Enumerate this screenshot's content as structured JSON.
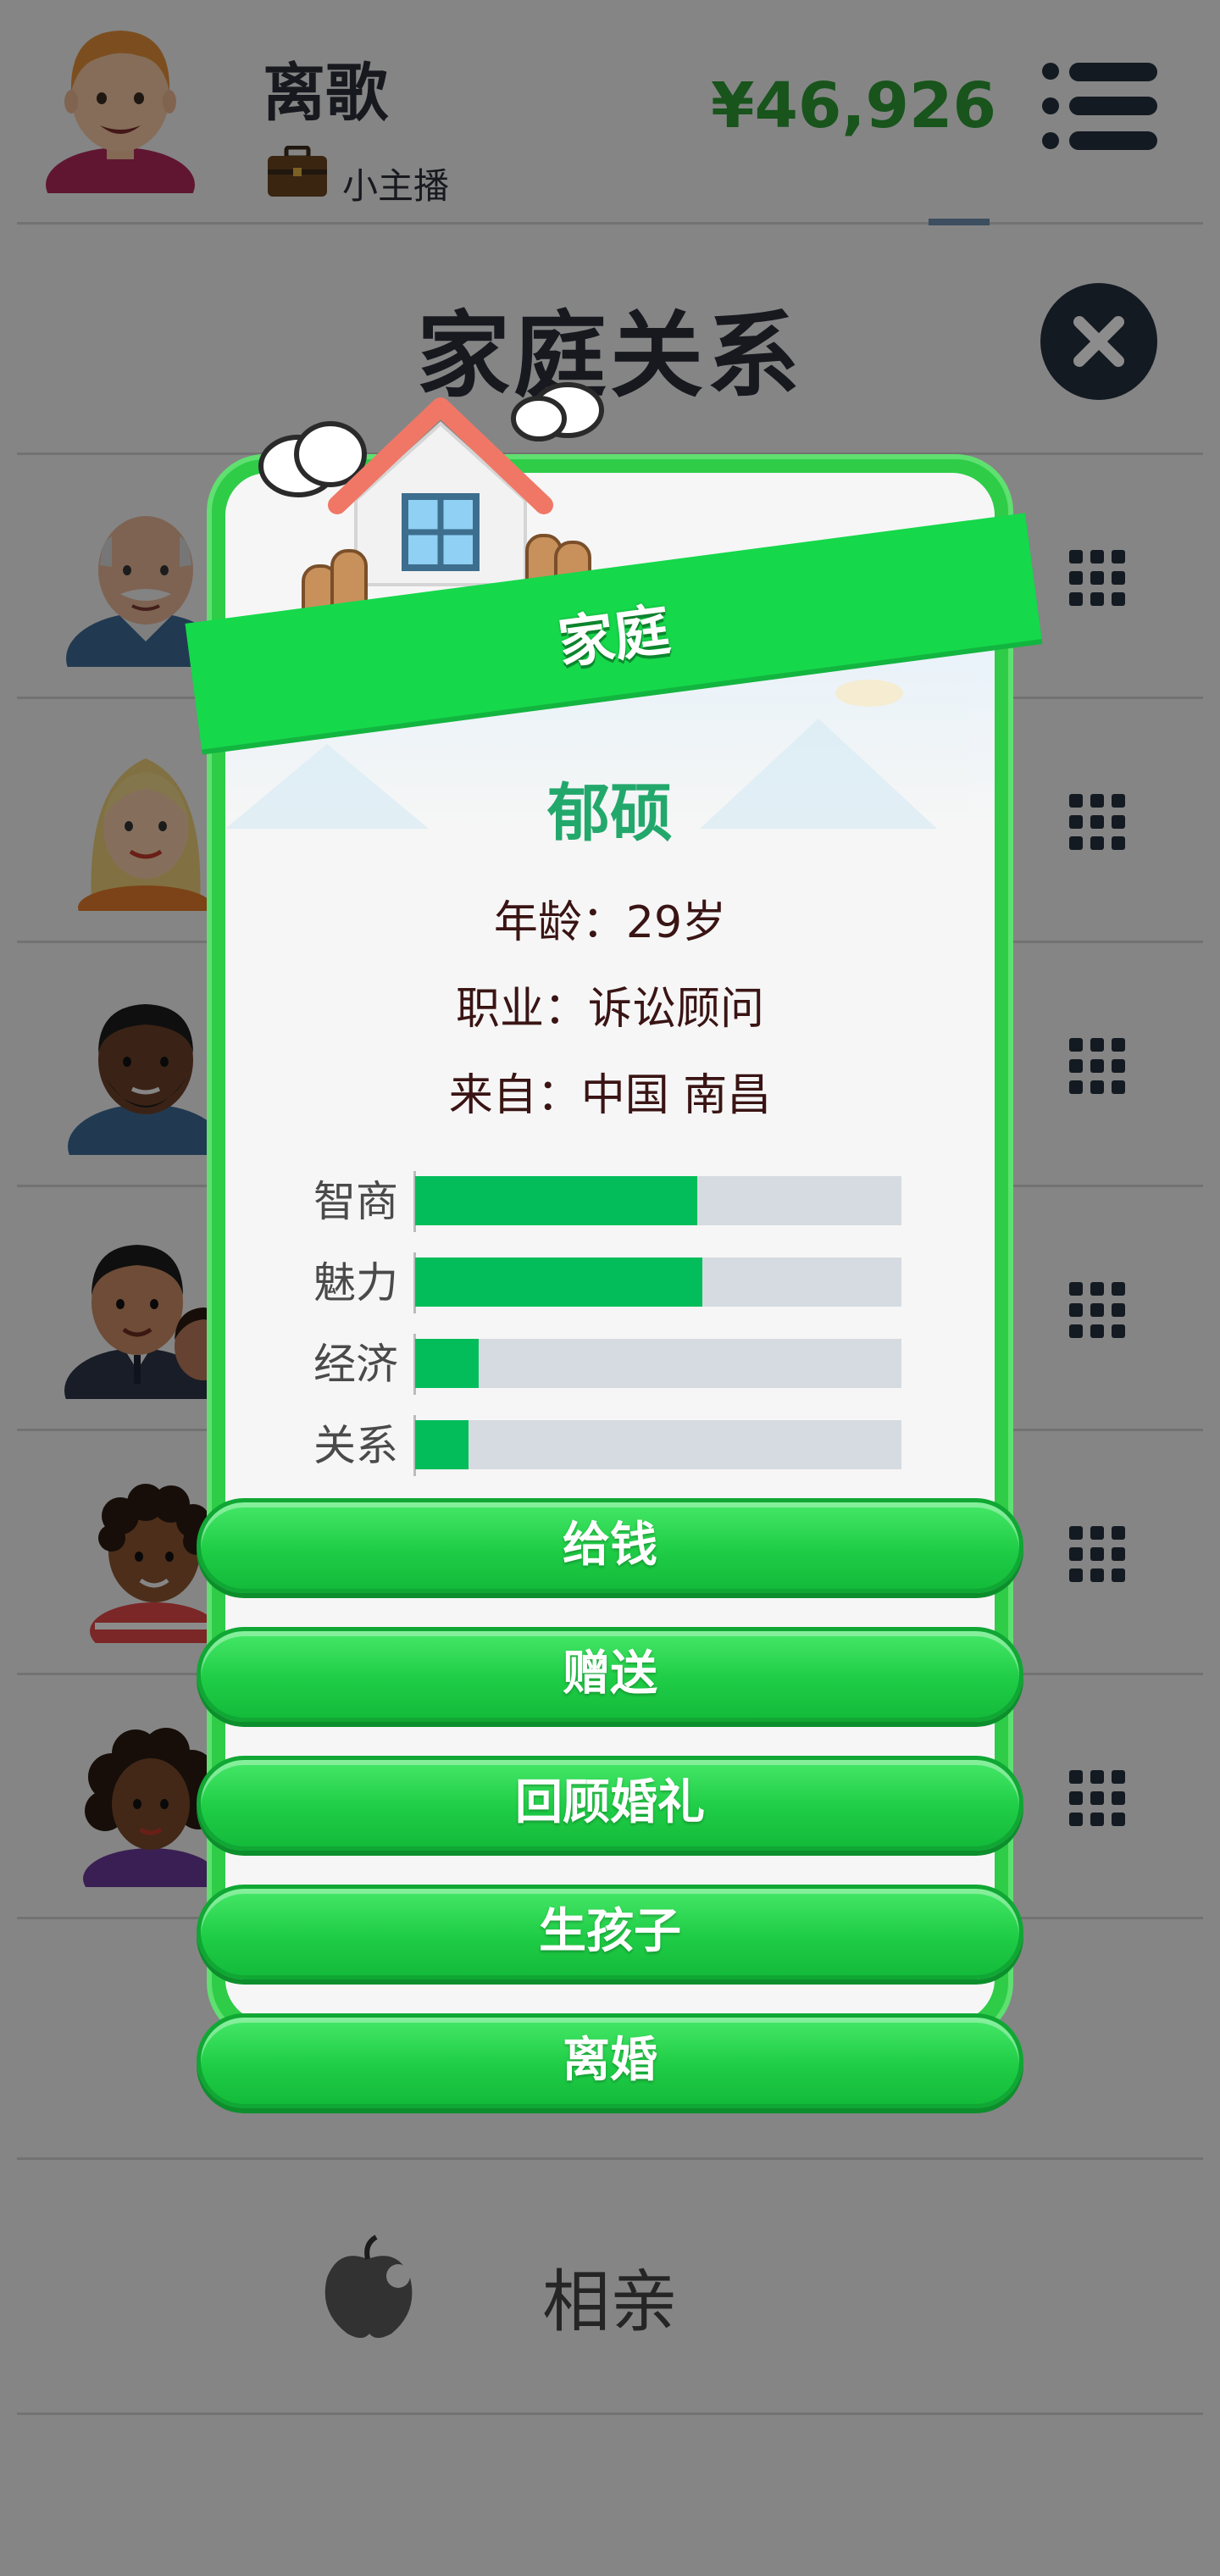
{
  "header": {
    "player_name": "离歌",
    "job": "小主播",
    "money": "¥46,926"
  },
  "panel": {
    "title": "家庭关系"
  },
  "family_rows": [
    {
      "avatar": "grandfather-avatar"
    },
    {
      "avatar": "blonde-woman-avatar"
    },
    {
      "avatar": "bearded-man-avatar"
    },
    {
      "avatar": "man-with-child-avatar"
    },
    {
      "avatar": "curly-hair-boy-avatar"
    },
    {
      "avatar": "curly-hair-girl-avatar"
    }
  ],
  "matchmaking": {
    "label": "相亲",
    "icon": "apple-icon"
  },
  "modal": {
    "banner": "家庭",
    "name": "郁硕",
    "age_line": "年龄：29岁",
    "job_line": "职业：诉讼顾问",
    "from_line": "来自：中国 南昌",
    "stats": [
      {
        "label": "智商",
        "value": 0.58
      },
      {
        "label": "魅力",
        "value": 0.59
      },
      {
        "label": "经济",
        "value": 0.13
      },
      {
        "label": "关系",
        "value": 0.11
      }
    ],
    "buttons": [
      "给钱",
      "赠送",
      "回顾婚礼",
      "生孩子",
      "离婚"
    ]
  },
  "colors": {
    "money": "#2c9a34",
    "frame": "#2fcc48",
    "stat_fill": "#03bd5b",
    "stat_track": "#d6dbe1",
    "name": "#23a86c",
    "overlay": "rgba(0,0,0,0.45)"
  }
}
